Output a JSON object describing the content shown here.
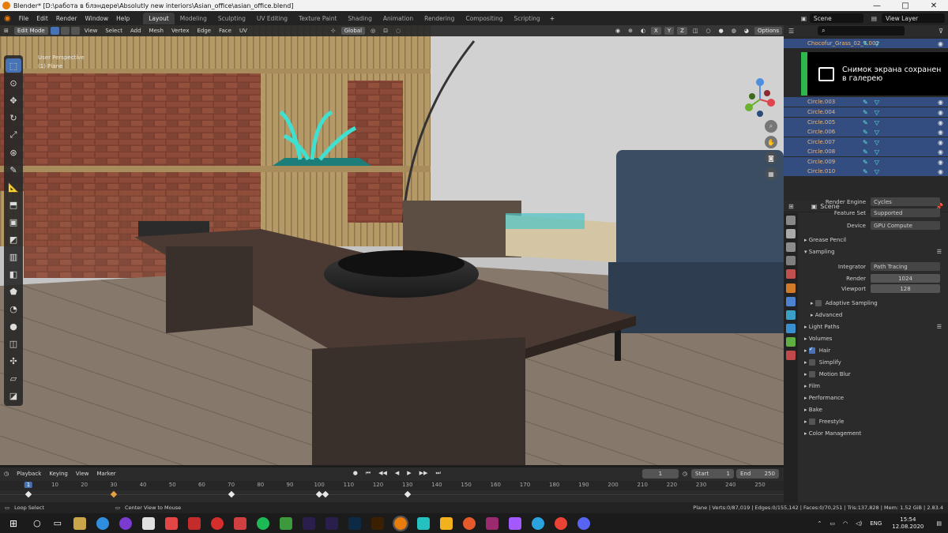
{
  "title": "Blender* [D:\\работа в блэндере\\Absolutly new interiors\\Asian_office\\asian_office.blend]",
  "window_controls": [
    "—",
    "□",
    "✕"
  ],
  "menu": [
    "File",
    "Edit",
    "Render",
    "Window",
    "Help"
  ],
  "workspaces": [
    "Layout",
    "Modeling",
    "Sculpting",
    "UV Editing",
    "Texture Paint",
    "Shading",
    "Animation",
    "Rendering",
    "Compositing",
    "Scripting"
  ],
  "active_workspace": "Layout",
  "scene_name": "Scene",
  "view_layer": "View Layer",
  "viewport": {
    "mode": "Edit Mode",
    "menus": [
      "View",
      "Select",
      "Add",
      "Mesh",
      "Vertex",
      "Edge",
      "Face",
      "UV"
    ],
    "orientation": "Global",
    "options_label": "Options",
    "axes": [
      "X",
      "Y",
      "Z"
    ],
    "info_line1": "User Perspective",
    "info_line2": "(1) Plane"
  },
  "toolbar_icons": [
    "select-box-icon",
    "cursor-icon",
    "move-icon",
    "rotate-icon",
    "scale-icon",
    "transform-icon",
    "annotate-icon",
    "measure-icon",
    "extrude-icon",
    "inset-icon",
    "bevel-icon",
    "loop-cut-icon",
    "knife-icon",
    "poly-build-icon",
    "spin-icon",
    "smooth-icon",
    "edge-slide-icon",
    "shrink-icon",
    "shear-icon",
    "rip-icon"
  ],
  "timeline": {
    "menus": [
      "Playback",
      "Keying",
      "View",
      "Marker"
    ],
    "current_frame": "1",
    "start_label": "Start",
    "start": "1",
    "end_label": "End",
    "end": "250",
    "ruler": [
      "1",
      "10",
      "20",
      "30",
      "40",
      "50",
      "60",
      "70",
      "80",
      "90",
      "100",
      "110",
      "120",
      "130",
      "140",
      "150",
      "160",
      "170",
      "180",
      "190",
      "200",
      "210",
      "220",
      "230",
      "240",
      "250"
    ]
  },
  "outliner": {
    "rows": [
      "Chocofur_Grass_02_7.002",
      "Circle.003",
      "Circle.004",
      "Circle.005",
      "Circle.006",
      "Circle.007",
      "Circle.008",
      "Circle.009",
      "Circle.010"
    ]
  },
  "toast": {
    "line1": "Снимок экрана сохранен",
    "line2": "в галерею"
  },
  "properties": {
    "header": "Scene",
    "render_engine_label": "Render Engine",
    "render_engine": "Cycles",
    "feature_set_label": "Feature Set",
    "feature_set": "Supported",
    "device_label": "Device",
    "device": "GPU Compute",
    "grease_pencil": "Grease Pencil",
    "sampling": "Sampling",
    "integrator_label": "Integrator",
    "integrator": "Path Tracing",
    "render_label": "Render",
    "render_samples": "1024",
    "viewport_label": "Viewport",
    "viewport_samples": "128",
    "adaptive_sampling": "Adaptive Sampling",
    "advanced": "Advanced",
    "light_paths": "Light Paths",
    "volumes": "Volumes",
    "hair": "Hair",
    "simplify": "Simplify",
    "motion_blur": "Motion Blur",
    "film": "Film",
    "performance": "Performance",
    "bake": "Bake",
    "freestyle": "Freestyle",
    "color_management": "Color Management"
  },
  "status": {
    "left": "Loop Select",
    "middle": "Center View to Mouse",
    "right": "Plane | Verts:0/87,019 | Edges:0/155,142 | Faces:0/70,251 | Tris:137,828 | Mem: 1.52 GiB | 2.83.4"
  },
  "taskbar": {
    "lang": "ENG",
    "time": "15:54",
    "date": "12.08.2020"
  }
}
